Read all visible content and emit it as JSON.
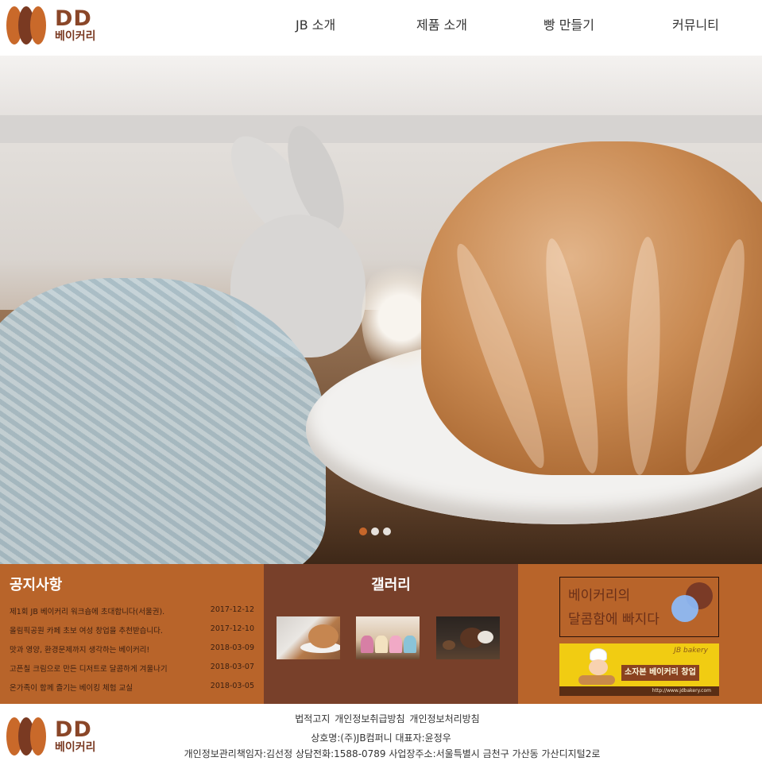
{
  "brand": {
    "name": "DD",
    "subname": "베이커리"
  },
  "nav": [
    {
      "label": "JB 소개"
    },
    {
      "label": "제품 소개"
    },
    {
      "label": "빵 만들기"
    },
    {
      "label": "커뮤니티"
    }
  ],
  "hero": {
    "slide_count": 3,
    "active_slide": 1
  },
  "notice": {
    "title": "공지사항",
    "items": [
      {
        "title": "제1회 JB 베이커리 워크숍에 초대합니다(서울권).",
        "date": "2017-12-12"
      },
      {
        "title": "올림픽공원 카페 초보 여성 창업을 추천받습니다.",
        "date": "2017-12-10"
      },
      {
        "title": "맛과 영양, 환경문제까지 생각하는 베이커리!",
        "date": "2018-03-09"
      },
      {
        "title": "고픈칠 크림으로 만든 디저트로 달콤하게 겨울나기",
        "date": "2018-03-07"
      },
      {
        "title": "온가족이 함께 즐기는 베이킹 체험 교실",
        "date": "2018-03-05"
      }
    ]
  },
  "gallery": {
    "title": "갤러리"
  },
  "banners": {
    "sweet": {
      "text": "베이커리의\n달콤함에 빠지다"
    },
    "startup": {
      "brand": "JB bakery",
      "slogan": "소자본 베이커리 창업",
      "url": "http://www.jdbakery.com"
    }
  },
  "footer": {
    "links": [
      "법적고지",
      "개인정보취급방침",
      "개인정보처리방침"
    ],
    "company": "상호명:(주)JB컴퍼니 대표자:윤정우",
    "contact": "개인정보관리책임자:김선정 상담전화:1588-0789 사업장주소:서울특별시 금천구 가산동 가산디지털2로"
  },
  "colors": {
    "brand_brown": "#7a3a22",
    "panel_orange": "#b8642a",
    "panel_dark": "#78402a",
    "dot_active": "#c6662a"
  }
}
